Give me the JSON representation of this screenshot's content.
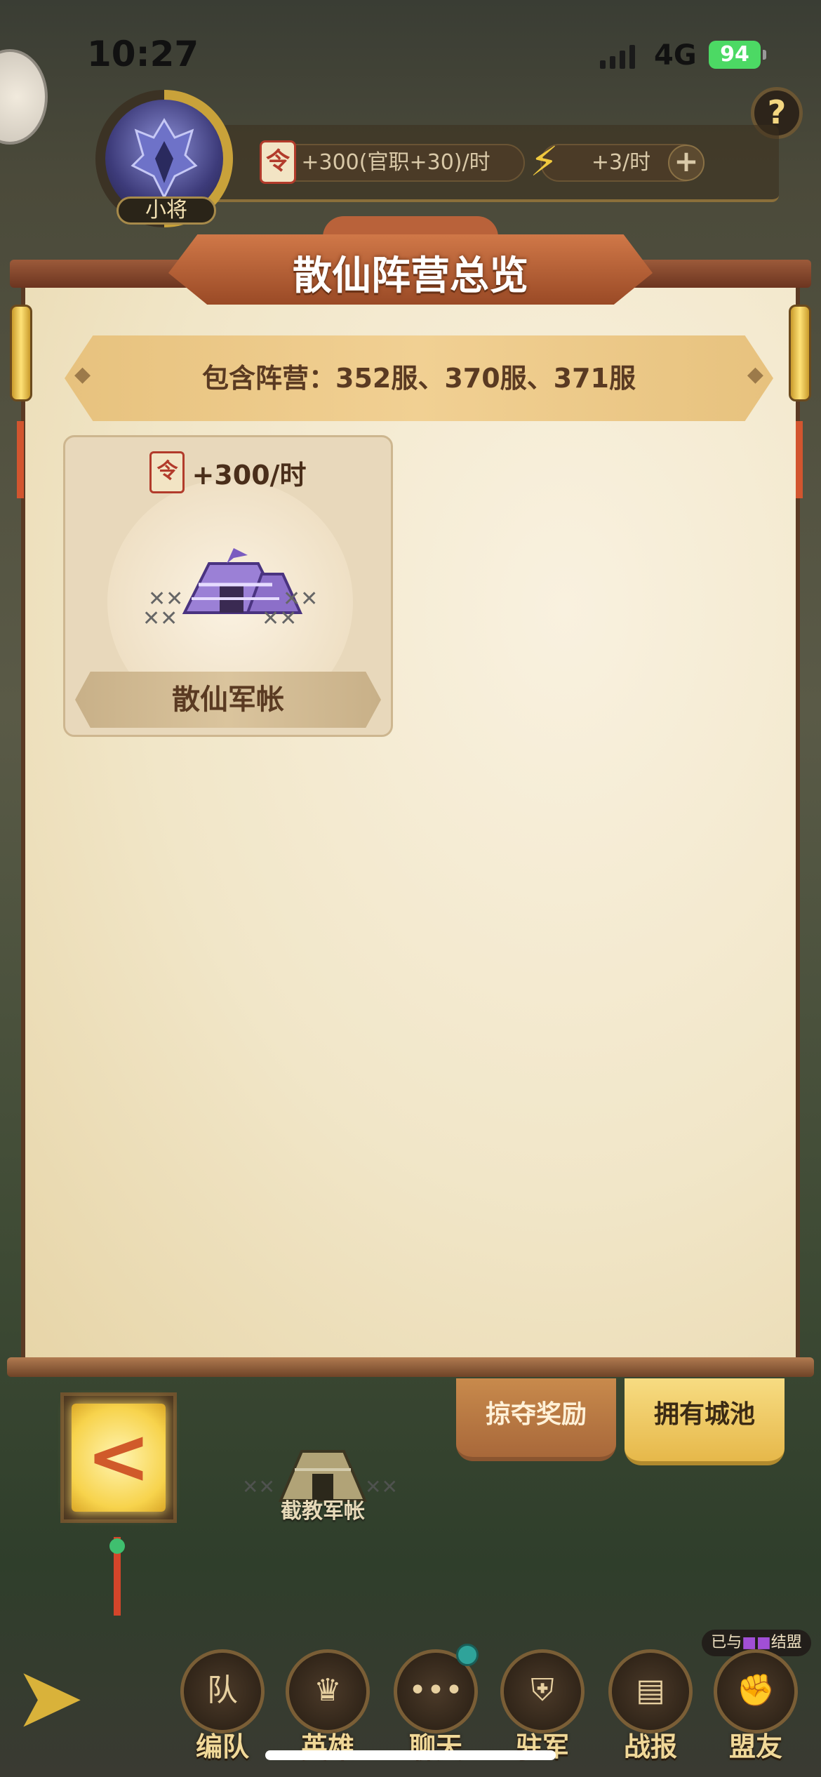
{
  "status_bar": {
    "time": "10:27",
    "network": "4G",
    "battery": "94"
  },
  "hud": {
    "rank": "小将",
    "income": "+300(官职+30)/时",
    "energy": "+3/时",
    "help": "?",
    "add": "+"
  },
  "panel": {
    "title": "散仙阵营总览",
    "servers": "包含阵营：352服、370服、371服",
    "camp": {
      "income": "+300/时",
      "name": "散仙军帐"
    }
  },
  "tabs": {
    "plunder": "掠夺奖励",
    "cities": "拥有城池"
  },
  "map": {
    "tent_label": "截教军帐"
  },
  "alliance_note": "已与",
  "alliance_note_end": "结盟",
  "nav": [
    {
      "label": "编队",
      "glyph": "队"
    },
    {
      "label": "英雄",
      "glyph": "♛"
    },
    {
      "label": "聊天",
      "glyph": "•••"
    },
    {
      "label": "驻军",
      "glyph": "⛨"
    },
    {
      "label": "战报",
      "glyph": "▤"
    },
    {
      "label": "盟友",
      "glyph": "✊"
    }
  ],
  "icons": {
    "income": "scroll-icon",
    "energy": "lightning-icon",
    "back": "chevron-left-icon"
  },
  "colors": {
    "accent_gold": "#f7d34c",
    "title_brown": "#9a4a26",
    "paper": "#f1e6c8",
    "battery_green": "#4cd964"
  }
}
